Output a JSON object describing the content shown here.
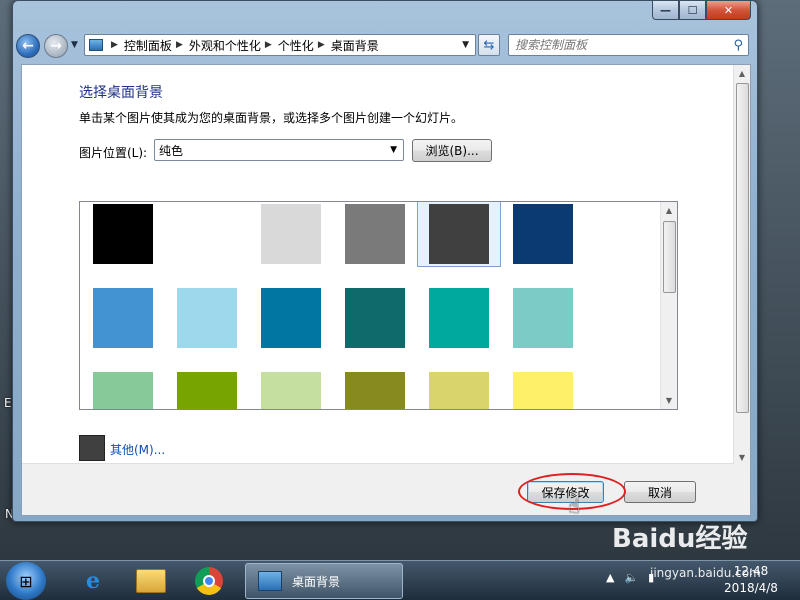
{
  "desktop": {
    "side_text_1": "Ev",
    "side_text_2": "N"
  },
  "window": {
    "minimize_glyph": "—",
    "maximize_glyph": "☐",
    "close_glyph": "✕"
  },
  "navigation": {
    "back_glyph": "←",
    "forward_glyph": "→",
    "breadcrumbs": [
      "控制面板",
      "外观和个性化",
      "个性化",
      "桌面背景"
    ],
    "search_placeholder": "搜索控制面板"
  },
  "main": {
    "title": "选择桌面背景",
    "description": "单击某个图片使其成为您的桌面背景，或选择多个图片创建一个幻灯片。",
    "picture_location_label": "图片位置(L):",
    "picture_location_value": "纯色",
    "browse_button": "浏览(B)...",
    "other_link": "其他(M)...",
    "other_color": "#404040",
    "selected_swatch_index": 4
  },
  "swatches": [
    {
      "color": "#000000"
    },
    {
      "color": "#ffffff"
    },
    {
      "color": "#d9d9d9"
    },
    {
      "color": "#7a7a7a"
    },
    {
      "color": "#404040"
    },
    {
      "color": "#0b3a73"
    },
    {
      "color": "#4393d3"
    },
    {
      "color": "#9ed8ec"
    },
    {
      "color": "#0276a3"
    },
    {
      "color": "#0f6b6b"
    },
    {
      "color": "#00a99d"
    },
    {
      "color": "#7dcbc7"
    },
    {
      "color": "#88c99a"
    },
    {
      "color": "#77a400"
    },
    {
      "color": "#c5dfa0"
    },
    {
      "color": "#878a1e"
    },
    {
      "color": "#d9d46c"
    },
    {
      "color": "#fff06a"
    }
  ],
  "footer": {
    "save_button": "保存修改",
    "cancel_button": "取消"
  },
  "taskbar": {
    "start_glyph": "⊞",
    "ie_glyph": "e",
    "active_task": "桌面背景",
    "clock_time": "12:48",
    "clock_date": "2018/4/8"
  },
  "watermark": {
    "brand": "Baidu经验",
    "url": "jingyan.baidu.com"
  }
}
